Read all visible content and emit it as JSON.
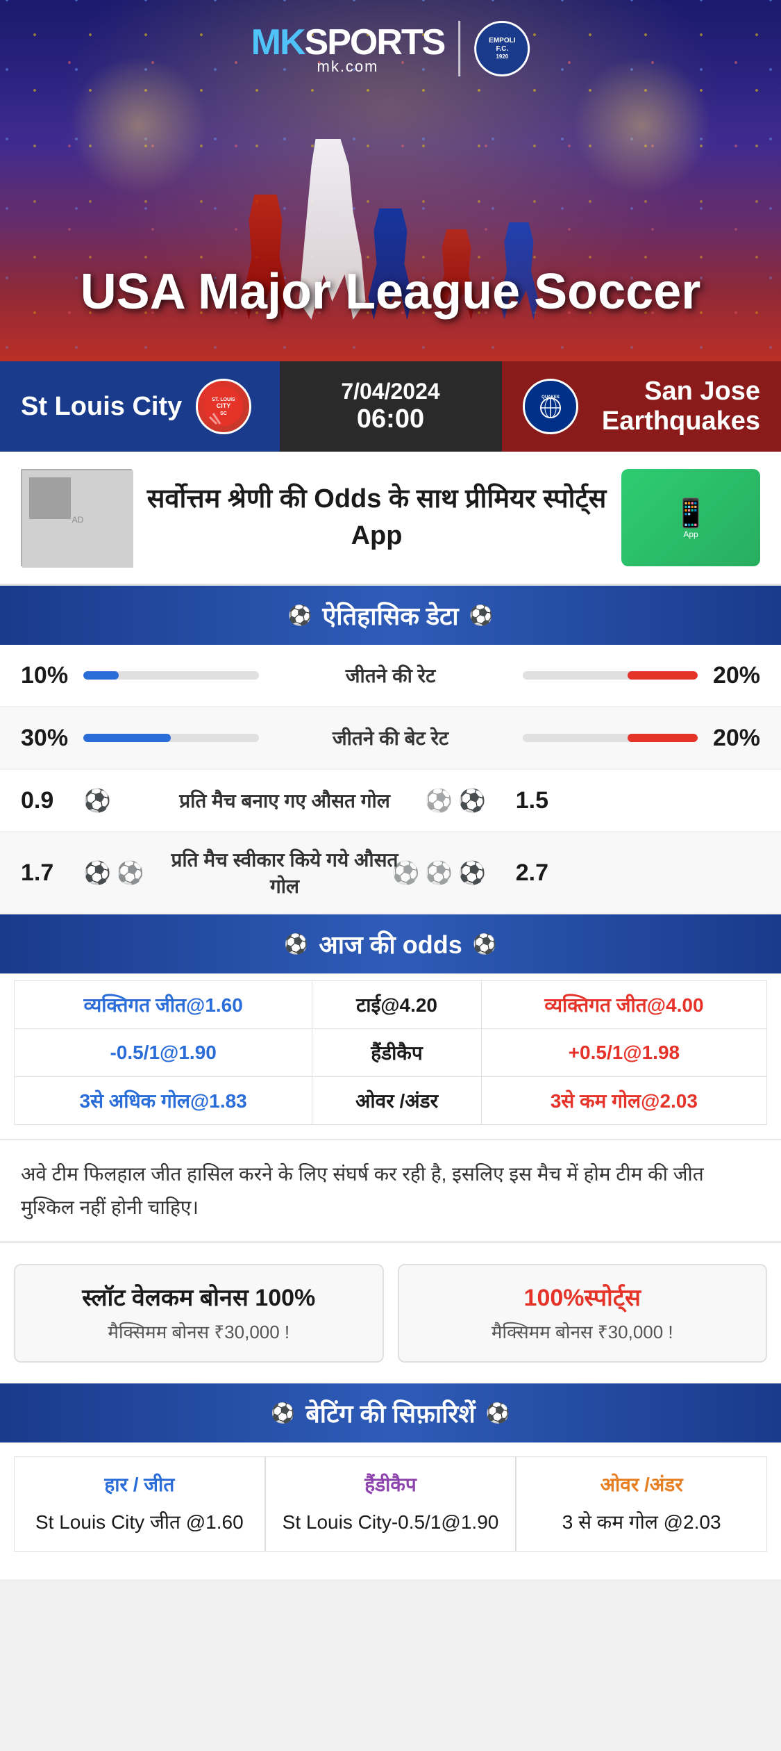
{
  "brand": {
    "name": "MK SPORTS",
    "mk": "MK",
    "sports": "SPORTS",
    "domain": "mk.com",
    "partner": "EMPOLI F.C.",
    "partner_year": "1920"
  },
  "league": {
    "name": "USA Major League Soccer"
  },
  "match": {
    "date": "7/04/2024",
    "time": "06:00",
    "home_team": "St Louis City",
    "away_team": "San Jose Earthquakes",
    "home_team_abbr": "CITY SC",
    "away_team_abbr": "QUAKES"
  },
  "promo": {
    "text": "सर्वोत्तम श्रेणी की Odds के साथ प्रीमियर स्पोर्ट्स App"
  },
  "historical": {
    "section_title": "ऐतिहासिक डेटा",
    "stats": [
      {
        "label": "जीतने की रेट",
        "left_value": "10%",
        "right_value": "20%",
        "left_pct": 10,
        "right_pct": 20
      },
      {
        "label": "जीतने की बेट रेट",
        "left_value": "30%",
        "right_value": "20%",
        "left_pct": 30,
        "right_pct": 20
      },
      {
        "label": "प्रति मैच बनाए गए औसत गोल",
        "left_value": "0.9",
        "right_value": "1.5",
        "left_icons": 1,
        "right_icons": 2
      },
      {
        "label": "प्रति मैच स्वीकार किये गये औसत गोल",
        "left_value": "1.7",
        "right_value": "2.7",
        "left_icons": 2,
        "right_icons": 3
      }
    ]
  },
  "odds": {
    "section_title": "आज की odds",
    "rows": [
      {
        "left": "व्यक्तिगत जीत@1.60",
        "center": "टाई@4.20",
        "right": "व्यक्तिगत जीत@4.00",
        "left_label": "",
        "center_label": "",
        "right_label": ""
      },
      {
        "left": "-0.5/1@1.90",
        "center": "हैंडीकैप",
        "right": "+0.5/1@1.98"
      },
      {
        "left": "3से अधिक गोल@1.83",
        "center": "ओवर /अंडर",
        "right": "3से कम गोल@2.03"
      }
    ]
  },
  "analysis": {
    "text": "अवे टीम फिलहाल जीत हासिल करने के लिए संघर्ष कर रही है, इसलिए इस मैच में होम टीम की जीत मुश्किल नहीं होनी चाहिए।"
  },
  "bonuses": [
    {
      "title": "स्लॉट वेलकम बोनस 100%",
      "subtitle": "मैक्सिमम बोनस ₹30,000  !"
    },
    {
      "title": "100%स्पोर्ट्स",
      "subtitle": "मैक्सिमम बोनस  ₹30,000 !"
    }
  ],
  "recommendations": {
    "section_title": "बेटिंग की सिफ़ारिशें",
    "items": [
      {
        "title": "हार / जीत",
        "value": "St Louis City जीत @1.60",
        "color": "blue"
      },
      {
        "title": "हैंडीकैप",
        "value": "St Louis City-0.5/1@1.90",
        "color": "purple"
      },
      {
        "title": "ओवर /अंडर",
        "value": "3 से कम गोल @2.03",
        "color": "orange"
      }
    ]
  }
}
